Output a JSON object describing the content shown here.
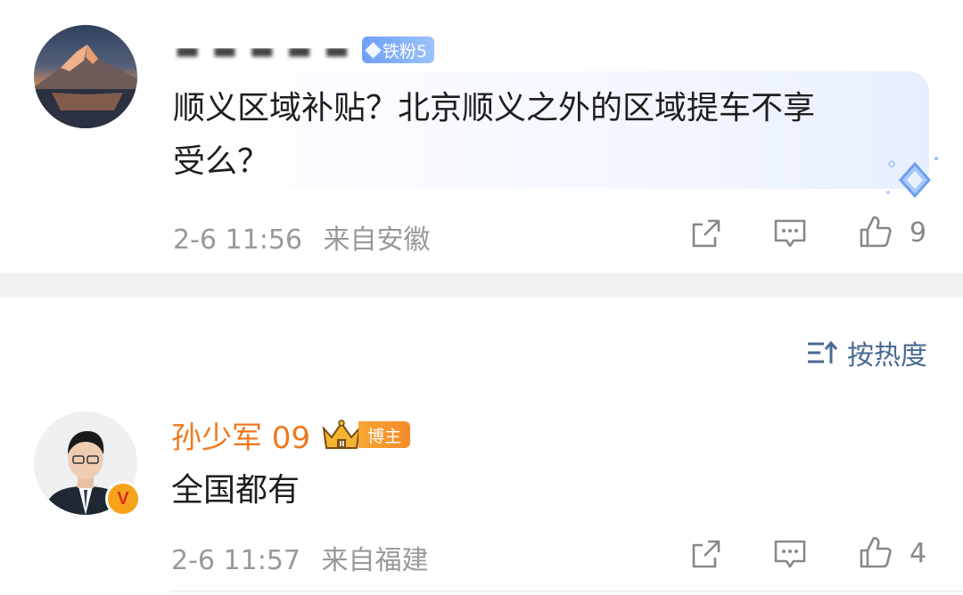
{
  "comment1": {
    "username": "▬ ▬ ▬ ▬ ▬",
    "badge": "铁粉5",
    "text_line1": "顺义区域补贴？北京顺义之外的区域提车不享",
    "text_line2": "受么？",
    "time": "2-6 11:56",
    "location": "来自安徽",
    "like_count": "9"
  },
  "sort": {
    "label": "按热度"
  },
  "comment2": {
    "username": "孙少军 09",
    "badge": "博主",
    "text": "全国都有",
    "time": "2-6 11:57",
    "location": "来自福建",
    "like_count": "4"
  },
  "colors": {
    "accent_blue": "#4a6a93",
    "name_orange": "#f07820",
    "meta_gray": "#999999"
  }
}
